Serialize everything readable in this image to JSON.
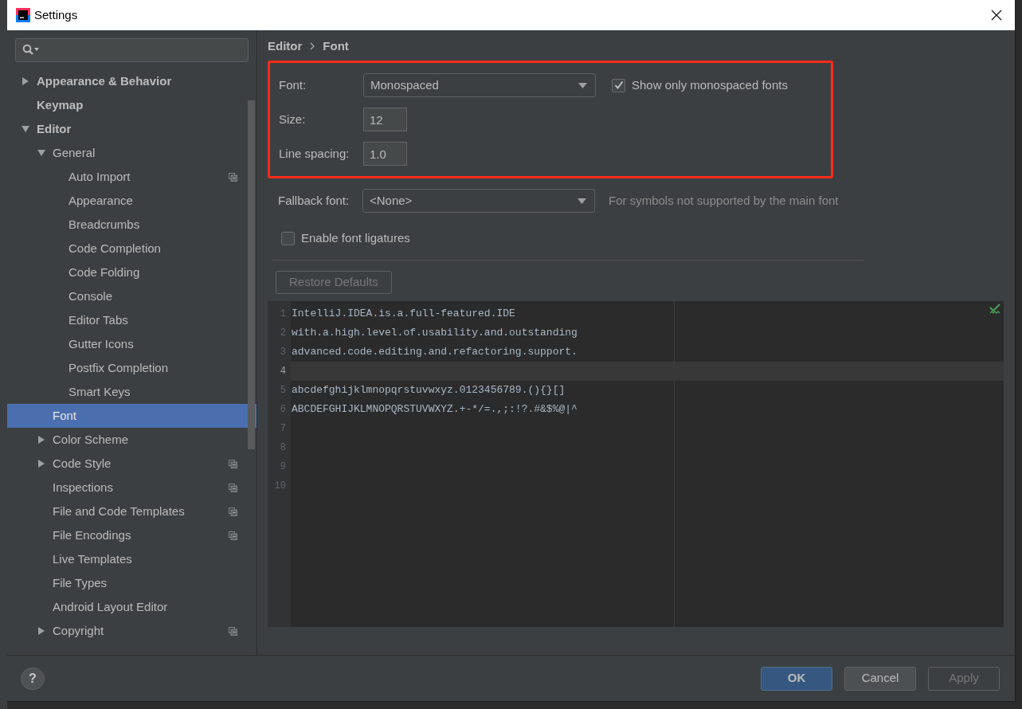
{
  "window": {
    "title": "Settings"
  },
  "sidebar": {
    "items": [
      {
        "label": "Appearance & Behavior",
        "expanded": false,
        "expandable": true,
        "selected": false,
        "project_level": false
      },
      {
        "label": "Keymap",
        "expandable": false,
        "selected": false,
        "project_level": false
      },
      {
        "label": "Editor",
        "expanded": true,
        "expandable": true,
        "selected": false,
        "project_level": false,
        "children": [
          {
            "label": "General",
            "expanded": true,
            "expandable": true,
            "selected": false,
            "project_level": false,
            "children": [
              {
                "label": "Auto Import",
                "expandable": false,
                "selected": false,
                "project_level": true
              },
              {
                "label": "Appearance",
                "expandable": false,
                "selected": false,
                "project_level": false
              },
              {
                "label": "Breadcrumbs",
                "expandable": false,
                "selected": false,
                "project_level": false
              },
              {
                "label": "Code Completion",
                "expandable": false,
                "selected": false,
                "project_level": false
              },
              {
                "label": "Code Folding",
                "expandable": false,
                "selected": false,
                "project_level": false
              },
              {
                "label": "Console",
                "expandable": false,
                "selected": false,
                "project_level": false
              },
              {
                "label": "Editor Tabs",
                "expandable": false,
                "selected": false,
                "project_level": false
              },
              {
                "label": "Gutter Icons",
                "expandable": false,
                "selected": false,
                "project_level": false
              },
              {
                "label": "Postfix Completion",
                "expandable": false,
                "selected": false,
                "project_level": false
              },
              {
                "label": "Smart Keys",
                "expandable": false,
                "selected": false,
                "project_level": false
              }
            ]
          },
          {
            "label": "Font",
            "expandable": false,
            "selected": true,
            "project_level": false
          },
          {
            "label": "Color Scheme",
            "expanded": false,
            "expandable": true,
            "selected": false,
            "project_level": false
          },
          {
            "label": "Code Style",
            "expanded": false,
            "expandable": true,
            "selected": false,
            "project_level": true
          },
          {
            "label": "Inspections",
            "expandable": false,
            "selected": false,
            "project_level": true
          },
          {
            "label": "File and Code Templates",
            "expandable": false,
            "selected": false,
            "project_level": true
          },
          {
            "label": "File Encodings",
            "expandable": false,
            "selected": false,
            "project_level": true
          },
          {
            "label": "Live Templates",
            "expandable": false,
            "selected": false,
            "project_level": false
          },
          {
            "label": "File Types",
            "expandable": false,
            "selected": false,
            "project_level": false
          },
          {
            "label": "Android Layout Editor",
            "expandable": false,
            "selected": false,
            "project_level": false
          },
          {
            "label": "Copyright",
            "expanded": false,
            "expandable": true,
            "selected": false,
            "project_level": true
          }
        ]
      }
    ]
  },
  "breadcrumb": [
    "Editor",
    "Font"
  ],
  "font_group": {
    "highlighted": true,
    "font": {
      "label": "Font:",
      "value": "Monospaced"
    },
    "show_monospaced": {
      "label": "Show only monospaced fonts",
      "checked": true
    },
    "size": {
      "label": "Size:",
      "value": "12"
    },
    "line_spacing": {
      "label": "Line spacing:",
      "value": "1.0"
    }
  },
  "fallback": {
    "label": "Fallback font:",
    "value": "<None>",
    "hint": "For symbols not supported by the main font"
  },
  "ligatures": {
    "label": "Enable font ligatures",
    "checked": false
  },
  "restore_button": {
    "label": "Restore Defaults",
    "disabled": true
  },
  "preview": {
    "lines": [
      {
        "number": "1",
        "text": "IntelliJ.IDEA.is.a.full-featured.IDE",
        "current": false
      },
      {
        "number": "2",
        "text": "with.a.high.level.of.usability.and.outstanding",
        "current": false
      },
      {
        "number": "3",
        "text": "advanced.code.editing.and.refactoring.support.",
        "current": false
      },
      {
        "number": "4",
        "current": true
      },
      {
        "number": "5",
        "text": "abcdefghijklmnopqrstuvwxyz.0123456789.(){}[]",
        "current": false
      },
      {
        "number": "6",
        "text": "ABCDEFGHIJKLMNOPQRSTUVWXYZ.+-*/=.,;:!?.#&$%@|^",
        "current": false
      },
      {
        "number": "7",
        "current": false
      },
      {
        "number": "8",
        "current": false
      },
      {
        "number": "9",
        "current": false
      },
      {
        "number": "10",
        "current": false
      }
    ]
  },
  "help_button": {
    "label": "?"
  },
  "buttons": [
    {
      "label": "OK",
      "kind": "primary",
      "disabled": false
    },
    {
      "label": "Cancel",
      "kind": "normal",
      "disabled": false
    },
    {
      "label": "Apply",
      "kind": "normal",
      "disabled": true
    }
  ]
}
